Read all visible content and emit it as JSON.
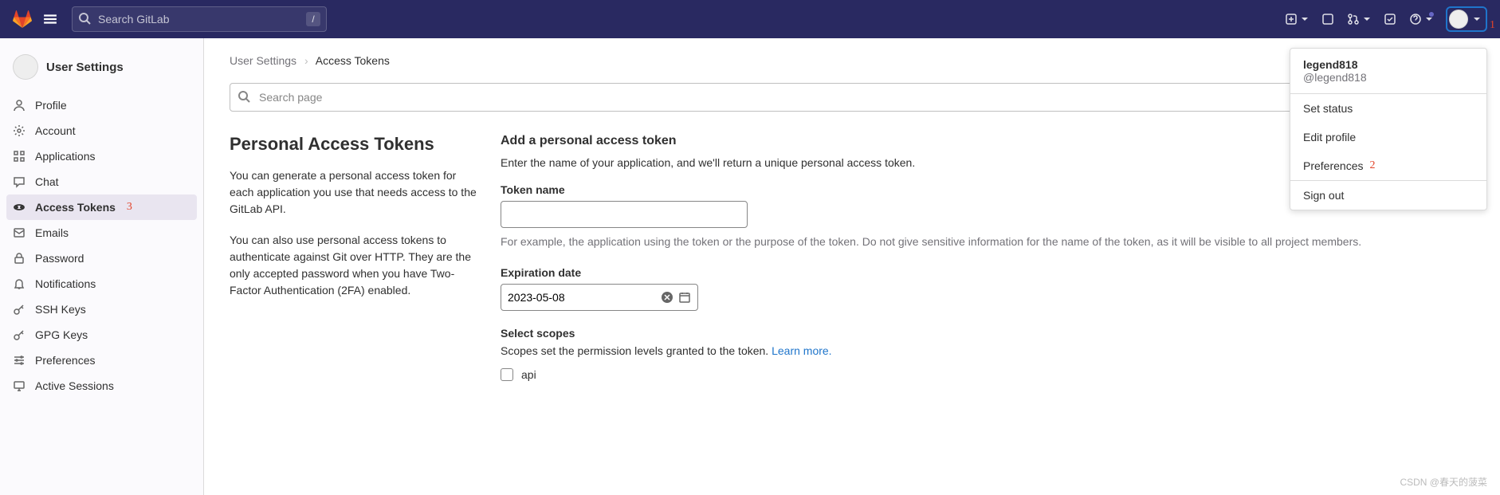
{
  "header": {
    "search_placeholder": "Search GitLab",
    "slash_key": "/"
  },
  "annotations": {
    "a1": "1",
    "a2": "2",
    "a3": "3"
  },
  "sidebar": {
    "title": "User Settings",
    "items": [
      {
        "label": "Profile"
      },
      {
        "label": "Account"
      },
      {
        "label": "Applications"
      },
      {
        "label": "Chat"
      },
      {
        "label": "Access Tokens"
      },
      {
        "label": "Emails"
      },
      {
        "label": "Password"
      },
      {
        "label": "Notifications"
      },
      {
        "label": "SSH Keys"
      },
      {
        "label": "GPG Keys"
      },
      {
        "label": "Preferences"
      },
      {
        "label": "Active Sessions"
      }
    ]
  },
  "breadcrumb": {
    "root": "User Settings",
    "current": "Access Tokens"
  },
  "page_search_placeholder": "Search page",
  "left_col": {
    "title": "Personal Access Tokens",
    "p1": "You can generate a personal access token for each application you use that needs access to the GitLab API.",
    "p2": "You can also use personal access tokens to authenticate against Git over HTTP. They are the only accepted password when you have Two-Factor Authentication (2FA) enabled."
  },
  "form": {
    "section_title": "Add a personal access token",
    "section_help": "Enter the name of your application, and we'll return a unique personal access token.",
    "token_name_label": "Token name",
    "token_name_value": "",
    "token_name_help": "For example, the application using the token or the purpose of the token. Do not give sensitive information for the name of the token, as it will be visible to all project members.",
    "expires_label": "Expiration date",
    "expires_value": "2023-05-08",
    "scopes_label": "Select scopes",
    "scopes_help_text": "Scopes set the permission levels granted to the token. ",
    "scopes_learn_more": "Learn more.",
    "scope_api": "api"
  },
  "user_menu": {
    "name": "legend818",
    "handle": "@legend818",
    "items": {
      "set_status": "Set status",
      "edit_profile": "Edit profile",
      "preferences": "Preferences",
      "sign_out": "Sign out"
    }
  },
  "watermark": "CSDN @春天的菠菜"
}
